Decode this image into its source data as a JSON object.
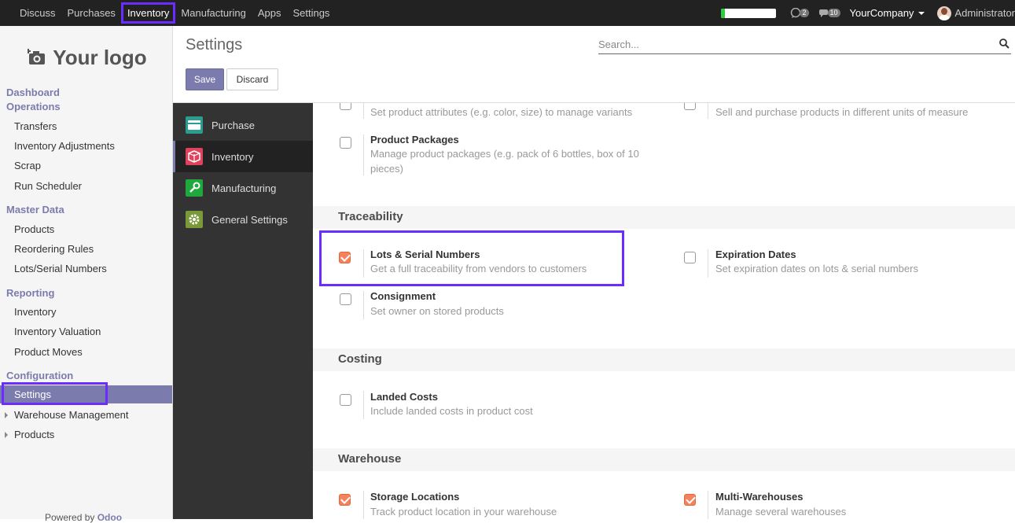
{
  "topbar": {
    "menu": [
      "Discuss",
      "Purchases",
      "Inventory",
      "Manufacturing",
      "Apps",
      "Settings"
    ],
    "active": "Inventory",
    "progress_fraction": 0.06,
    "chat_count": "2",
    "messages_count": "10",
    "company": "YourCompany",
    "user": "Administrator"
  },
  "sidebar": {
    "logo_text": "Your logo",
    "sections": {
      "dashboard": "Dashboard",
      "operations": "Operations",
      "master_data": "Master Data",
      "reporting": "Reporting",
      "configuration": "Configuration"
    },
    "operations_items": [
      "Transfers",
      "Inventory Adjustments",
      "Scrap",
      "Run Scheduler"
    ],
    "master_data_items": [
      "Products",
      "Reordering Rules",
      "Lots/Serial Numbers"
    ],
    "reporting_items": [
      "Inventory",
      "Inventory Valuation",
      "Product Moves"
    ],
    "configuration_items": [
      "Settings",
      "Warehouse Management",
      "Products"
    ],
    "active_item": "Settings",
    "powered_prefix": "Powered by",
    "powered_brand": "Odoo"
  },
  "header": {
    "title": "Settings",
    "search_placeholder": "Search...",
    "save_label": "Save",
    "discard_label": "Discard"
  },
  "appnav": [
    {
      "label": "Purchase",
      "icon": "purchase-icon",
      "color": "#2a9d8f"
    },
    {
      "label": "Inventory",
      "icon": "inventory-icon",
      "color": "#e0415c"
    },
    {
      "label": "Manufacturing",
      "icon": "manufacturing-icon",
      "color": "#1fa83b"
    },
    {
      "label": "General Settings",
      "icon": "general-settings-icon",
      "color": "#7a9a3a"
    }
  ],
  "content": {
    "top_partial": {
      "left_desc": "Set product attributes (e.g. color, size) to manage variants",
      "right_desc": "Sell and purchase products in different units of measure"
    },
    "product_packages": {
      "title": "Product Packages",
      "desc_line1": "Manage product packages (e.g. pack of 6 bottles, box of 10",
      "desc_line2": "pieces)"
    },
    "traceability": {
      "heading": "Traceability",
      "lots": {
        "title": "Lots & Serial Numbers",
        "desc": "Get a full traceability from vendors to customers",
        "checked": true
      },
      "expiration": {
        "title": "Expiration Dates",
        "desc": "Set expiration dates on lots & serial numbers",
        "checked": false
      },
      "consignment": {
        "title": "Consignment",
        "desc": "Set owner on stored products",
        "checked": false
      }
    },
    "costing": {
      "heading": "Costing",
      "landed": {
        "title": "Landed Costs",
        "desc": "Include landed costs in product cost",
        "checked": false
      }
    },
    "warehouse": {
      "heading": "Warehouse",
      "storage": {
        "title": "Storage Locations",
        "desc": "Track product location in your warehouse",
        "checked": true
      },
      "multi": {
        "title": "Multi-Warehouses",
        "desc": "Manage several warehouses",
        "checked": true
      }
    }
  }
}
